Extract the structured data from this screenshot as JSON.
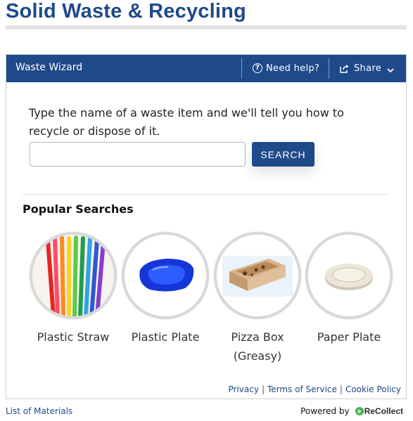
{
  "page": {
    "title": "Solid Waste & Recycling"
  },
  "widget": {
    "header": {
      "title": "Waste Wizard",
      "help_label": "Need help?",
      "share_label": "Share"
    },
    "instructions": "Type the name of a waste item and we'll tell you how to recycle or dispose of it.",
    "search": {
      "value": "",
      "placeholder": "",
      "button_label": "SEARCH"
    },
    "popular": {
      "heading": "Popular Searches",
      "items": [
        {
          "label": "Plastic Straw",
          "icon": "plastic-straw-image"
        },
        {
          "label": "Plastic Plate",
          "icon": "plastic-plate-image"
        },
        {
          "label": "Pizza Box (Greasy)",
          "icon": "pizza-box-image"
        },
        {
          "label": "Paper Plate",
          "icon": "paper-plate-image"
        }
      ]
    },
    "footer_links": {
      "privacy": "Privacy",
      "terms": "Terms of Service",
      "cookie": "Cookie Policy",
      "separator": "|"
    }
  },
  "bottom": {
    "list_materials": "List of Materials",
    "powered_by": "Powered by",
    "logo_text": "ReCollect"
  },
  "colors": {
    "brand_blue": "#1f4a8a",
    "logo_green": "#4caf50"
  }
}
